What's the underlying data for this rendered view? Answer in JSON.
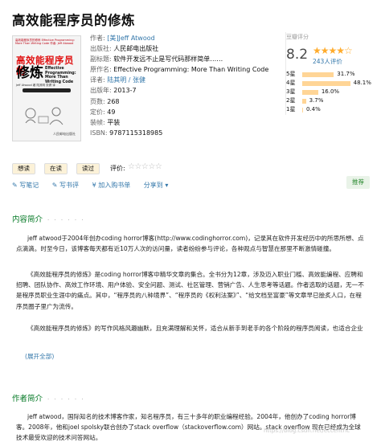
{
  "title": "高效能程序员的修炼",
  "cover": {
    "top_text": "高效能程序员的修炼 Effective Programming: More Than Writing Code 作者: Jeff Atwood",
    "title_line1": "高效能程序员的",
    "title_line2": "修炼",
    "title_en": "Effective Programming: More Than Writing Code",
    "subtitle": "Jeff Atwood 著   陆其明 张健 译",
    "publisher_mark": "人民邮电出版社"
  },
  "info": {
    "author_label": "作者:",
    "author_value": "[美]Jeff Atwood",
    "publisher_label": "出版社:",
    "publisher_value": "人民邮电出版社",
    "subtitle_label": "副标题:",
    "subtitle_value": "软件开发远不止是写代码那样简单……",
    "original_label": "原作名:",
    "original_value": "Effective Programming: More Than Writing Code",
    "translator_label": "译者:",
    "translator_value": "陆其明 / 张健",
    "pubyear_label": "出版年:",
    "pubyear_value": "2013-7",
    "pages_label": "页数:",
    "pages_value": "268",
    "price_label": "定价:",
    "price_value": "49",
    "binding_label": "装帧:",
    "binding_value": "平装",
    "isbn_label": "ISBN:",
    "isbn_value": "9787115318985"
  },
  "rating": {
    "title": "豆瓣评分",
    "score": "8.2",
    "stars": "★★★★☆",
    "count": "243人评价",
    "distribution": [
      {
        "label": "5星",
        "percent": 31.7,
        "text": "31.7%"
      },
      {
        "label": "4星",
        "percent": 48.1,
        "text": "48.1%"
      },
      {
        "label": "3星",
        "percent": 16.0,
        "text": "16.0%"
      },
      {
        "label": "2星",
        "percent": 3.7,
        "text": "3.7%"
      },
      {
        "label": "1星",
        "percent": 0.4,
        "text": "0.4%"
      }
    ]
  },
  "actions": {
    "want_read": "想读",
    "reading": "在读",
    "read": "读过",
    "rate_label": "评价:",
    "rate_stars": "☆☆☆☆☆"
  },
  "links": {
    "write_note": "✎ 写笔记",
    "write_review": "✎ 写书评",
    "add_cart": "¥ 加入购书单",
    "share": "分享到 ▾",
    "recommend": "推荐"
  },
  "sections": {
    "intro_title": "内容简介",
    "intro_dots": "· · · · · ·",
    "intro_p1": "jeff atwood于2004年创办coding horror博客(http://www.codinghorror.com)，记录其在软件开发经历中的所思所想、点点滴滴。时至今日，该博客每天都有近10万人次的访问量，读者纷纷参与评论，各种观点与智慧在那里不断激情碰撞。",
    "intro_p2": "《高效能程序员的修炼》是coding horror博客中精华文章的集合。全书分为12章，涉及迈入职业门槛、高效能编程、应聘和招聘、团队协作、高效工作环境、用户体验、安全问题、测试、社区管理、营销广告、人生思考等话题。作者选取的话题，无一不是程序员职业生涯中的痛点。其中，“程序员的八种境界”、“程序员的《权利法案》”、“给文档至富豪”等文章早已脍炙人口，在程序员圈子里广为流传。",
    "intro_p3": "《高效能程序员的修炼》的写作风格风趣幽默，且充满理解和关怀，适合从新手到老手的各个阶段的程序员阅读，也适合企业",
    "expand": "(展开全部)",
    "author_title": "作者简介",
    "author_dots": "· · · · · ·",
    "author_p1": "jeff atwood，国际知名的技术博客作家，知名程序员，有三十多年的职业编程经验。2004年，他创办了coding horror博客。2008年，他和joel spolsky联合创办了stack overflow（stackoverflow.com）网站。stack overflow 现在已经成为全球技术最受欢迎的技术问答网站。"
  },
  "watermark": "https://blog.csdn.net/eccentric",
  "colors": {
    "link": "#3377aa",
    "section_title": "#007722",
    "star": "#ffac2d",
    "bar": "#ffd596",
    "recommend_bg": "#e9f3e8"
  }
}
